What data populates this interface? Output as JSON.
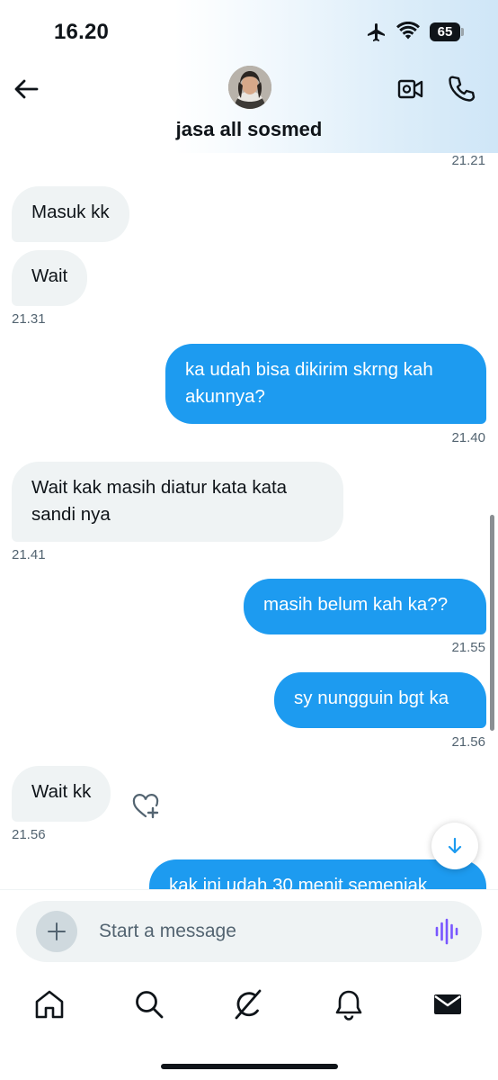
{
  "status_bar": {
    "time": "16.20",
    "battery": "65"
  },
  "header": {
    "contact_name": "jasa all sosmed"
  },
  "messages": [
    {
      "text": "Masuk kk"
    },
    {
      "text": "Wait"
    },
    {
      "text": "ka udah bisa dikirim skrng kah akunnya?"
    },
    {
      "text": "Wait kak masih diatur kata kata sandi nya"
    },
    {
      "text": "masih belum kah ka??"
    },
    {
      "text": "sy nungguin bgt ka"
    },
    {
      "text": "Wait kk"
    },
    {
      "text": "kak ini udah 30 menit semenjak"
    }
  ],
  "timestamps": [
    "21.21",
    "21.31",
    "21.40",
    "21.41",
    "21.55",
    "21.56",
    "21.56"
  ],
  "composer": {
    "placeholder": "Start a message"
  },
  "icons": {
    "back": "arrow-left-icon",
    "video": "video-camera-icon",
    "call": "phone-icon",
    "react": "heart-plus-icon",
    "scroll": "arrow-down-icon",
    "add": "plus-icon",
    "voice": "voice-wave-icon",
    "nav": [
      "home-icon",
      "search-icon",
      "grok-icon",
      "bell-icon",
      "mail-icon"
    ]
  },
  "colors": {
    "accent": "#1d9bf0",
    "incoming_bubble": "#eff3f4",
    "voice_icon": "#7856ff"
  }
}
